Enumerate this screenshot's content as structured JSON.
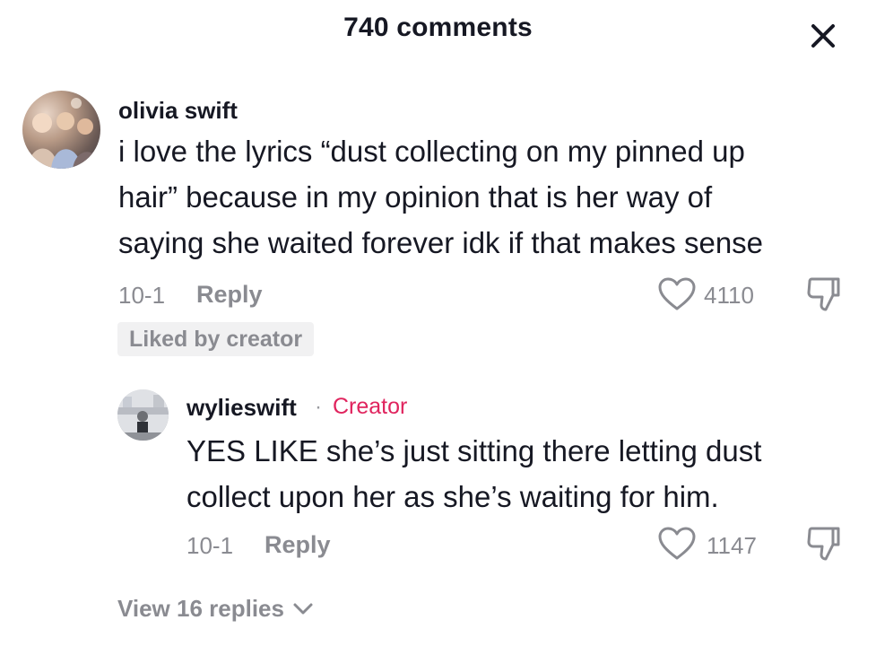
{
  "header": {
    "title": "740 comments"
  },
  "comment": {
    "username": "olivia swift",
    "text": "i love the lyrics “dust collecting on my pinned up\nhair” because in my opinion that is her way of\nsaying she waited forever idk if that makes sense",
    "date": "10-1",
    "reply_label": "Reply",
    "likes": "4110",
    "liked_badge": "Liked by creator"
  },
  "reply": {
    "username": "wylieswift",
    "separator": "·",
    "creator_label": "Creator",
    "text": "YES LIKE she’s just sitting there letting dust\ncollect upon her as she’s waiting for him.",
    "date": "10-1",
    "reply_label": "Reply",
    "likes": "1147"
  },
  "view_replies": {
    "label": "View 16 replies"
  },
  "icons": {
    "close": "close-icon",
    "like": "heart-icon",
    "dislike": "thumbs-down-icon",
    "expand": "chevron-down-icon"
  },
  "colors": {
    "text_primary": "#161823",
    "text_secondary": "#8a8b91",
    "creator_accent": "#e0245e",
    "badge_bg": "#f1f1f2"
  }
}
